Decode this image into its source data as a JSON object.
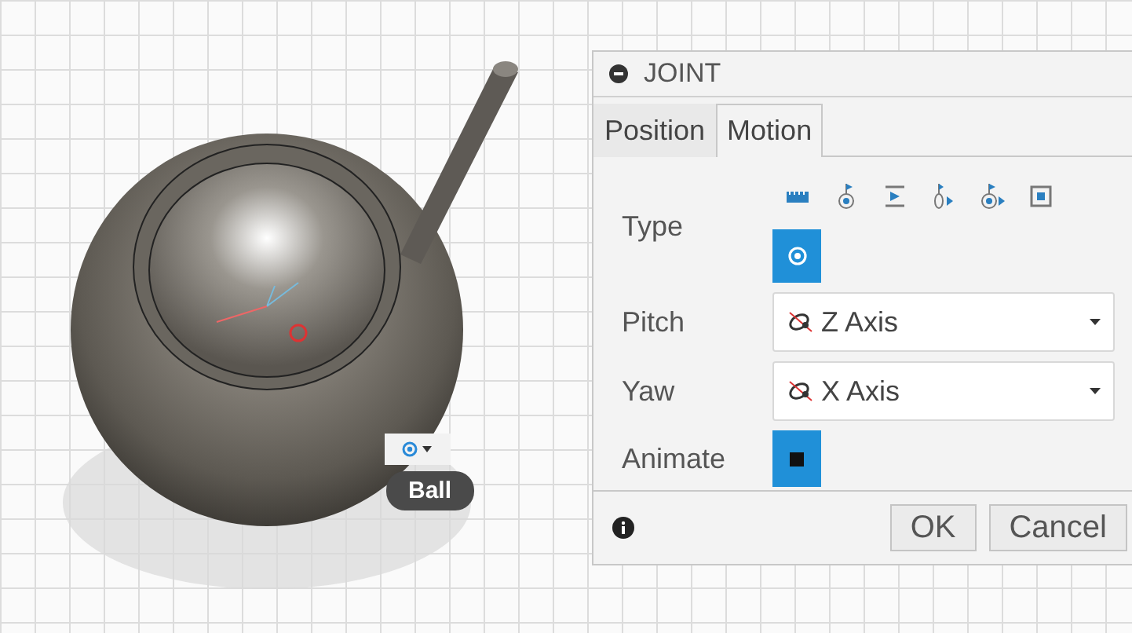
{
  "viewport": {
    "joint_badge": {
      "label": "Ball"
    }
  },
  "dialog": {
    "title": "JOINT",
    "tabs": [
      {
        "label": "Position",
        "selected": false
      },
      {
        "label": "Motion",
        "selected": true
      }
    ],
    "type": {
      "label": "Type",
      "options": [
        {
          "kind": "rigid",
          "selected": false
        },
        {
          "kind": "revolute",
          "selected": false
        },
        {
          "kind": "slider",
          "selected": false
        },
        {
          "kind": "cylindrical",
          "selected": false
        },
        {
          "kind": "pin-slot",
          "selected": false
        },
        {
          "kind": "planar",
          "selected": false
        },
        {
          "kind": "ball",
          "selected": true
        }
      ]
    },
    "axes": [
      {
        "label": "Pitch",
        "value": "Z Axis"
      },
      {
        "label": "Yaw",
        "value": "X Axis"
      }
    ],
    "animate": {
      "label": "Animate"
    },
    "buttons": [
      "OK",
      "Cancel"
    ]
  }
}
